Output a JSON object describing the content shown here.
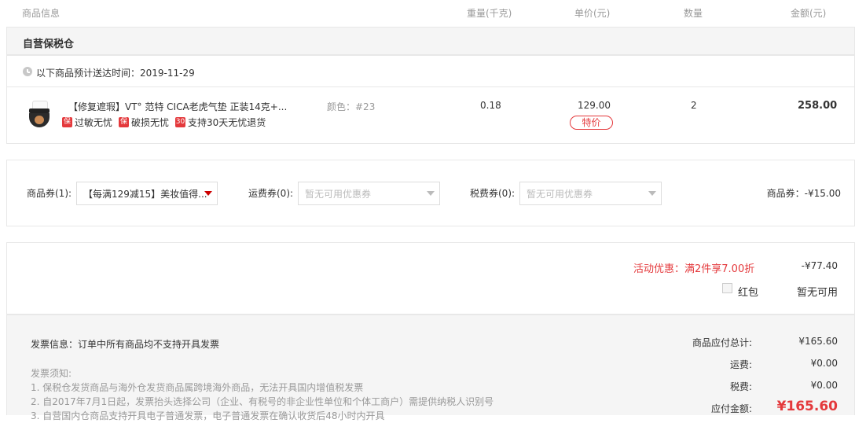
{
  "header": {
    "product_info": "商品信息",
    "weight": "重量(千克)",
    "unit_price": "单价(元)",
    "quantity": "数量",
    "amount": "金额(元)"
  },
  "warehouse": {
    "title": "自营保税仓",
    "delivery_text": "以下商品预计送达时间：2019-11-29"
  },
  "item": {
    "name": "【修复遮瑕】VT° 范特 CICA老虎气垫 正装14克+...",
    "tags": [
      "过敏无忧",
      "破损无忧",
      "支持30天无忧退货"
    ],
    "tag_icons": [
      "保",
      "保",
      "30"
    ],
    "color": "颜色：#23",
    "weight": "0.18",
    "price": "129.00",
    "special": "特价",
    "quantity": "2",
    "amount": "258.00"
  },
  "coupons": {
    "product_label": "商品券(1):",
    "product_value": "【每满129减15】美妆值得...",
    "shipping_label": "运费券(0):",
    "shipping_placeholder": "暂无可用优惠券",
    "tax_label": "税费券(0):",
    "tax_placeholder": "暂无可用优惠券",
    "discount_text": "商品券：-¥15.00"
  },
  "promo": {
    "activity": "活动优惠：满2件享7.00折",
    "activity_value": "-¥77.40",
    "red_packet": "红包",
    "red_packet_status": "暂无可用"
  },
  "invoice": {
    "info": "发票信息：订单中所有商品均不支持开具发票",
    "notes_title": "发票须知:",
    "note1": "1. 保税仓发货商品与海外仓发货商品属跨境海外商品，无法开具国内增值税发票",
    "note2": "2. 自2017年7月1日起，发票抬头选择公司（企业、有税号的非企业性单位和个体工商户）需提供纳税人识别号",
    "note3": "3. 自营国内仓商品支持开具电子普通发票，电子普通发票在确认收货后48小时内开具"
  },
  "summary": {
    "subtotal_label": "商品应付总计:",
    "subtotal": "¥165.60",
    "shipping_label": "运费:",
    "shipping": "¥0.00",
    "tax_label": "税费:",
    "tax": "¥0.00",
    "due_label": "应付金额:",
    "due": "¥165.60"
  },
  "colors": {
    "accent_red": "#e4393c",
    "border": "#e8e8e8",
    "panel_bg": "#f5f5f5"
  }
}
